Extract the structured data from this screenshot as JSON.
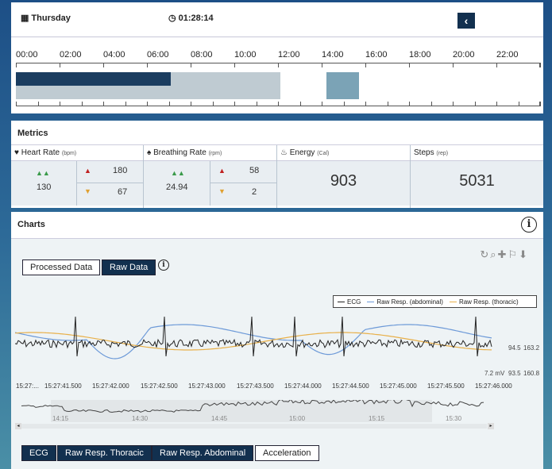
{
  "header": {
    "day": "Thursday",
    "time": "01:28:14",
    "back_icon": "chevron-left"
  },
  "timeline": {
    "hours": [
      "00:00",
      "02:00",
      "04:00",
      "06:00",
      "08:00",
      "10:00",
      "12:00",
      "14:00",
      "16:00",
      "18:00",
      "20:00",
      "22:00"
    ],
    "segments": [
      {
        "start_h": 0,
        "end_h": 7.1,
        "color": "#1b3d60",
        "row": "top"
      },
      {
        "start_h": 0,
        "end_h": 12.1,
        "color": "#bfcbd2",
        "row": "full"
      },
      {
        "start_h": 14.2,
        "end_h": 15.7,
        "color": "#7ba3b6",
        "row": "full"
      }
    ]
  },
  "metrics": {
    "title": "Metrics",
    "heart": {
      "label": "Heart Rate",
      "unit": "(bpm)",
      "value": "130",
      "max": "180",
      "min": "67"
    },
    "breathing": {
      "label": "Breathing Rate",
      "unit": "(rpm)",
      "value": "24.94",
      "max": "58",
      "min": "2"
    },
    "energy": {
      "label": "Energy",
      "unit": "(Cal)",
      "value": "903"
    },
    "steps": {
      "label": "Steps",
      "unit": "(rep)",
      "value": "5031"
    }
  },
  "charts": {
    "title": "Charts",
    "info": "i",
    "tabs": [
      "Processed Data",
      "Raw Data"
    ],
    "legend": [
      "ECG",
      "Raw Resp. (abdominal)",
      "Raw Resp. (thoracic)"
    ],
    "colors": {
      "ecg": "#222",
      "abd": "#6d9ad8",
      "thor": "#e8b04a"
    },
    "y_labels": {
      "ecg_min": "7.2 mV",
      "abd_top": "94.5",
      "abd_bot": "93.5",
      "thor_top": "163.2",
      "thor_bot": "160.8"
    },
    "x_ticks": [
      "15:27:...",
      "15:27:41.500",
      "15:27:42.000",
      "15:27:42.500",
      "15:27:43.000",
      "15:27:43.500",
      "15:27:44.000",
      "15:27:44.500",
      "15:27:45.000",
      "15:27:45.500",
      "15:27:46.000"
    ],
    "nav_ticks": [
      "14:15",
      "14:30",
      "14:45",
      "15:00",
      "15:15",
      "15:30"
    ],
    "buttons": [
      "ECG",
      "Raw Resp. Thoracic",
      "Raw Resp. Abdominal",
      "Acceleration"
    ]
  }
}
